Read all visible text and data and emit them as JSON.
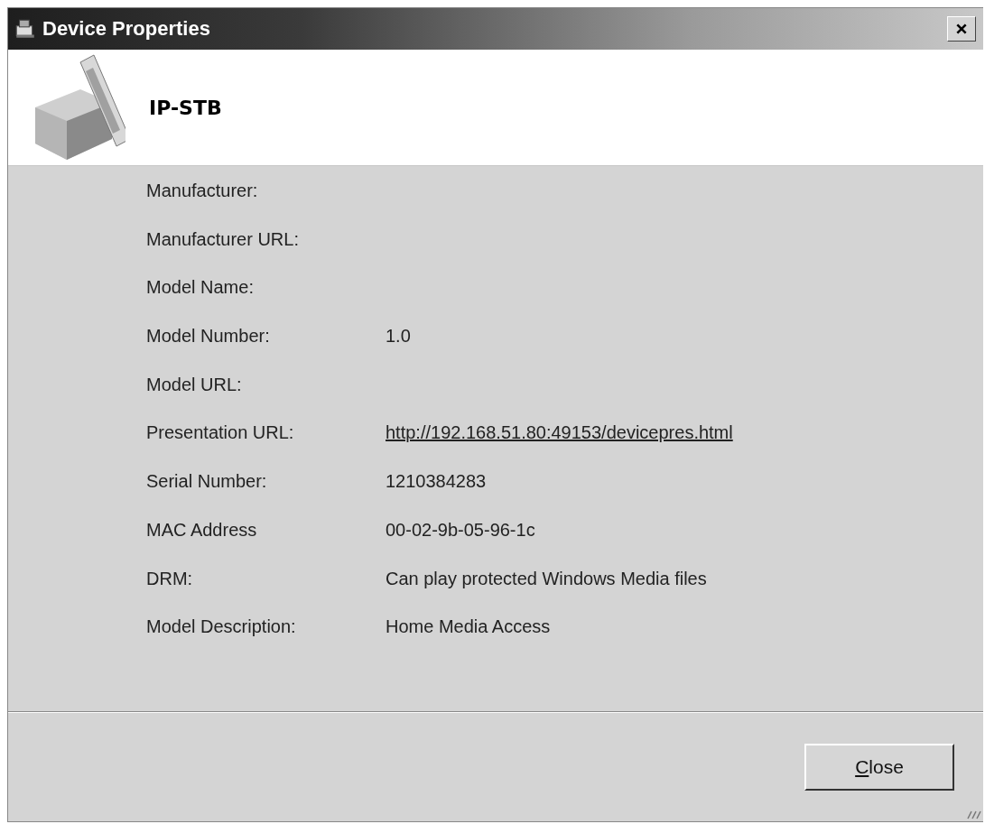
{
  "window": {
    "title": "Device Properties"
  },
  "header": {
    "device_name": "IP-STB"
  },
  "properties": [
    {
      "label": "Manufacturer:"
    },
    {
      "label": "Manufacturer URL:"
    },
    {
      "label": "Model Name:"
    },
    {
      "label": "Model Number:",
      "value": "1.0"
    },
    {
      "label": "Model URL:"
    },
    {
      "label": "Presentation URL:",
      "value": "http://192.168.51.80:49153/devicepres.html",
      "kind": "link"
    },
    {
      "label": "Serial Number:",
      "value": "1210384283"
    },
    {
      "label": "MAC Address",
      "value": "00-02-9b-05-96-1c"
    },
    {
      "label": "DRM:",
      "value": "Can play protected Windows Media files"
    },
    {
      "label": "Model Description:",
      "value": "Home Media Access"
    }
  ],
  "buttons": [
    {
      "label": "Close",
      "underline_first": true
    }
  ]
}
